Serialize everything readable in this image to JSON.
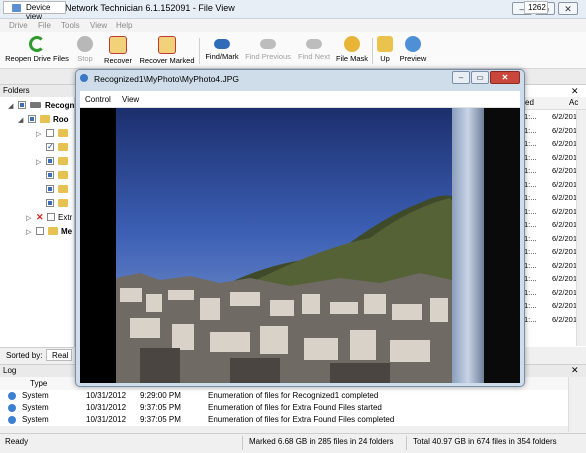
{
  "app": {
    "title": "R-STUDIO Network Technician 6.1.152091 - File View",
    "window_buttons": [
      "–",
      "▭",
      "✕"
    ]
  },
  "menu": [
    "Drive",
    "File",
    "Tools",
    "View",
    "Help"
  ],
  "toolbar": {
    "reopen": "Reopen Drive Files",
    "stop": "Stop",
    "recover": "Recover",
    "recover_marked": "Recover Marked",
    "find_mark": "Find/Mark",
    "find_previous": "Find Previous",
    "find_next": "Find Next",
    "file_mask": "File Mask",
    "up": "Up",
    "preview": "Preview"
  },
  "tabs": {
    "device_view": "Device view",
    "partial_1262": "1262"
  },
  "folders": {
    "header": "Folders",
    "root1": "Recogn",
    "root2": "Roo",
    "extra": "Extr",
    "me": "Me"
  },
  "sort": {
    "label": "Sorted by:",
    "value": "Real"
  },
  "files": {
    "col1": "ed",
    "col2": "Ac",
    "rows": [
      {
        "a": "1:...",
        "b": "6/2/2012"
      },
      {
        "a": "1:...",
        "b": "6/2/2012"
      },
      {
        "a": "1:...",
        "b": "6/2/2012"
      },
      {
        "a": "1:...",
        "b": "6/2/2012"
      },
      {
        "a": "1:...",
        "b": "6/2/2012"
      },
      {
        "a": "1:...",
        "b": "6/2/2012"
      },
      {
        "a": "1:...",
        "b": "6/2/2012"
      },
      {
        "a": "1:...",
        "b": "6/2/2012"
      },
      {
        "a": "1:...",
        "b": "6/2/2012"
      },
      {
        "a": "1:...",
        "b": "6/2/2012"
      },
      {
        "a": "1:...",
        "b": "6/2/2012"
      },
      {
        "a": "1:...",
        "b": "6/2/2012"
      },
      {
        "a": "1:...",
        "b": "6/2/2012"
      },
      {
        "a": "1:...",
        "b": "6/2/2012"
      },
      {
        "a": "1:...",
        "b": "6/2/2012"
      },
      {
        "a": "1:...",
        "b": "6/2/2012"
      }
    ]
  },
  "viewer": {
    "title": "Recognized1\\MyPhoto\\MyPhoto4.JPG",
    "menu": [
      "Control",
      "View"
    ],
    "buttons": [
      "–",
      "▭",
      "✕"
    ]
  },
  "log": {
    "header": "Log",
    "col_type": "Type",
    "rows": [
      {
        "type": "System",
        "date": "10/31/2012",
        "time": "9:29:00 PM",
        "text": "Enumeration of files for Recognized1 completed"
      },
      {
        "type": "System",
        "date": "10/31/2012",
        "time": "9:37:05 PM",
        "text": "Enumeration of files for Extra Found Files started"
      },
      {
        "type": "System",
        "date": "10/31/2012",
        "time": "9:37:05 PM",
        "text": "Enumeration of files for Extra Found Files completed"
      }
    ]
  },
  "status": {
    "ready": "Ready",
    "marked": "Marked 6.68 GB in 285 files in 24 folders",
    "total": "Total 40.97 GB in 674 files in 354 folders"
  }
}
